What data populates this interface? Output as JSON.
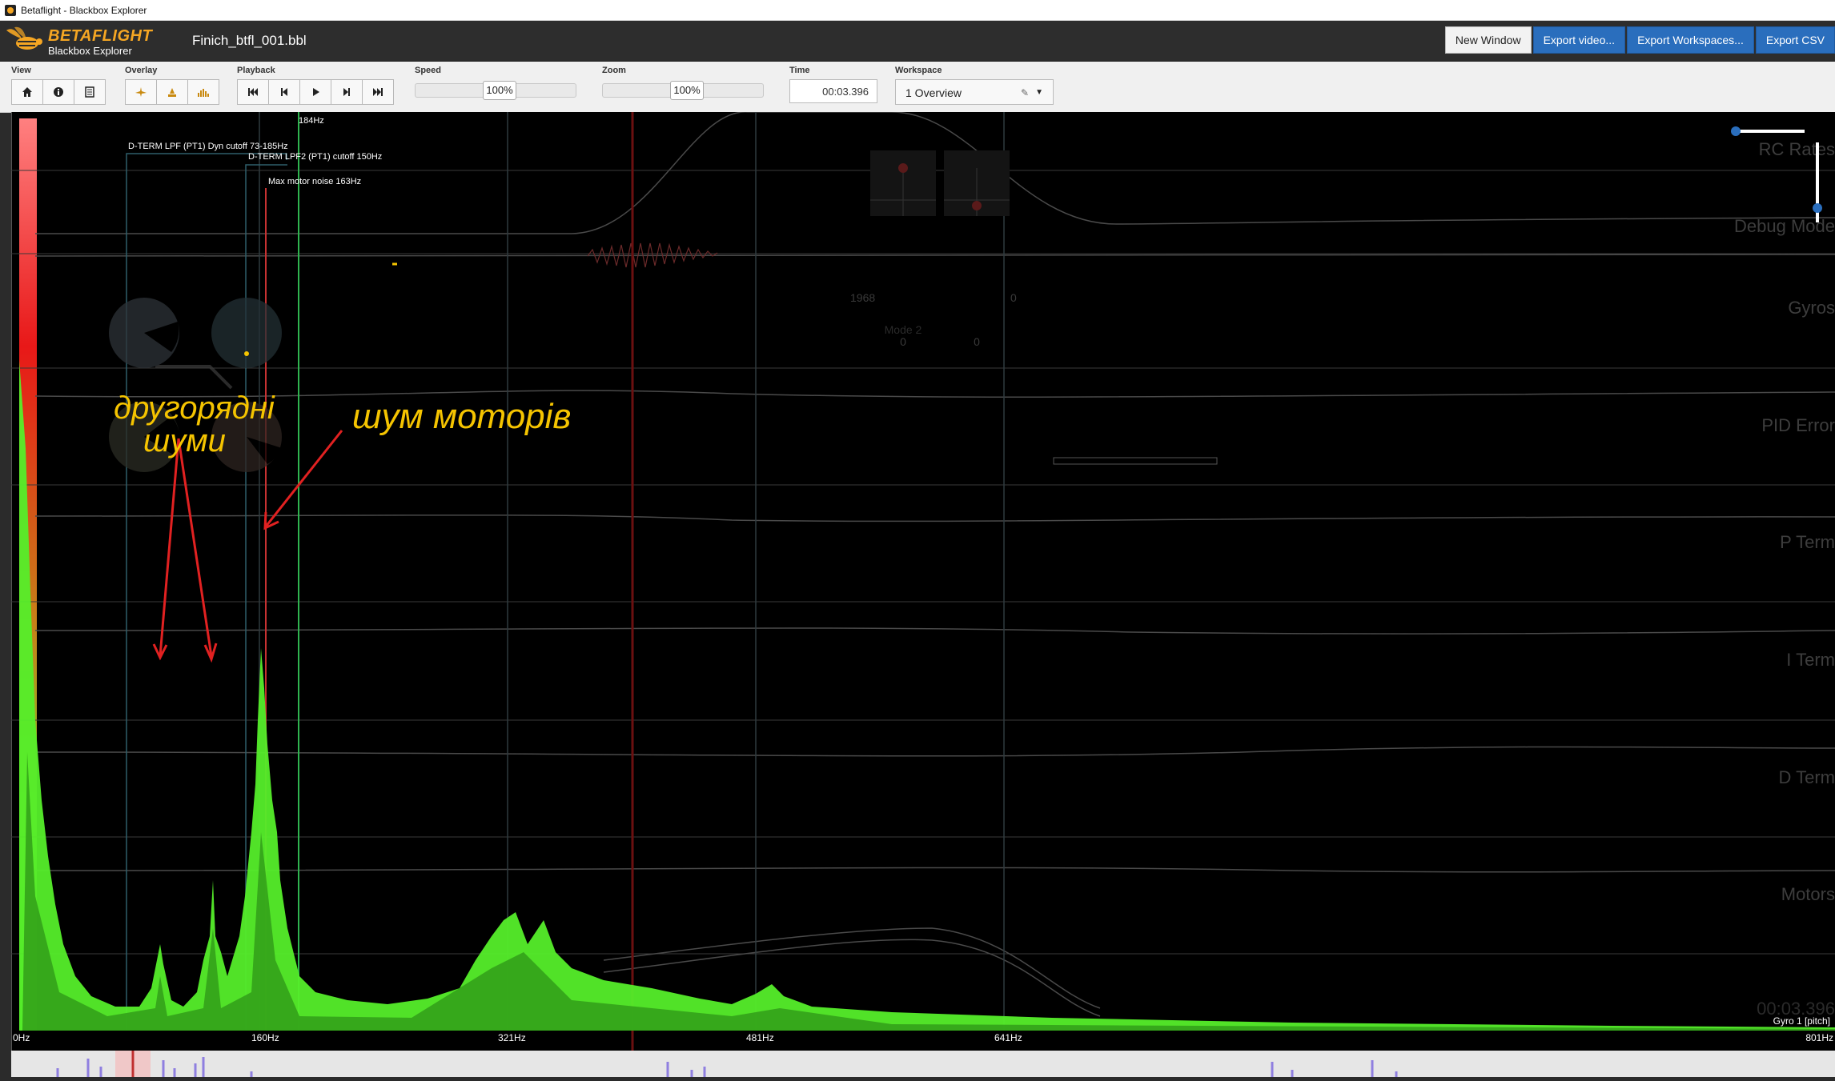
{
  "window": {
    "title": "Betaflight - Blackbox Explorer"
  },
  "header": {
    "logo_title": "BETAFLIGHT",
    "logo_subtitle": "Blackbox Explorer",
    "file_name": "Finich_btfl_001.bbl",
    "buttons": [
      "New Window",
      "Export video...",
      "Export Workspaces...",
      "Export CSV"
    ]
  },
  "toolbar": {
    "view_label": "View",
    "overlay_label": "Overlay",
    "playback_label": "Playback",
    "speed_label": "Speed",
    "speed_value": "100%",
    "zoom_label": "Zoom",
    "zoom_value": "100%",
    "time_label": "Time",
    "time_value": "00:03.396",
    "workspace_label": "Workspace",
    "workspace_value": "1 Overview",
    "icons": {
      "view": [
        "home-icon",
        "info-icon",
        "list-icon"
      ],
      "overlay": [
        "craft-icon",
        "sticks-icon",
        "analyser-icon"
      ],
      "playback": [
        "skip-back-icon",
        "step-back-icon",
        "play-icon",
        "step-forward-icon",
        "skip-forward-icon"
      ]
    }
  },
  "analyser": {
    "x_ticks": [
      "0Hz",
      "160Hz",
      "321Hz",
      "481Hz",
      "641Hz",
      "801Hz"
    ],
    "markers": {
      "dterm_lpf": "D-TERM LPF (PT1) Dyn cutoff 73-185Hz",
      "dterm_lpf2": "D-TERM LPF2 (PT1) cutoff 150Hz",
      "motor_noise": "Max motor noise 163Hz",
      "cursor_freq": "184Hz"
    },
    "graph_title": "Gyro 1 [pitch]",
    "time_overlay": "00:03.396"
  },
  "graph_labels": [
    "RC Rates",
    "Debug Mode",
    "Gyros",
    "PID Error",
    "P Term",
    "I Term",
    "D Term",
    "Motors"
  ],
  "sticks": {
    "left_value": "1968",
    "right_value": "0",
    "mode_label": "Mode 2",
    "bottom_left": "0",
    "bottom_right": "0"
  },
  "annotations": {
    "secondary_noise": [
      "другорядні",
      "шуми"
    ],
    "motor_noise": "шум моторів"
  },
  "colors": {
    "accent": "#2a6ebd",
    "brand": "#f5a623",
    "spectrum": "#55ee2a",
    "annotation": "#f5c400",
    "arrow": "#e12121"
  }
}
